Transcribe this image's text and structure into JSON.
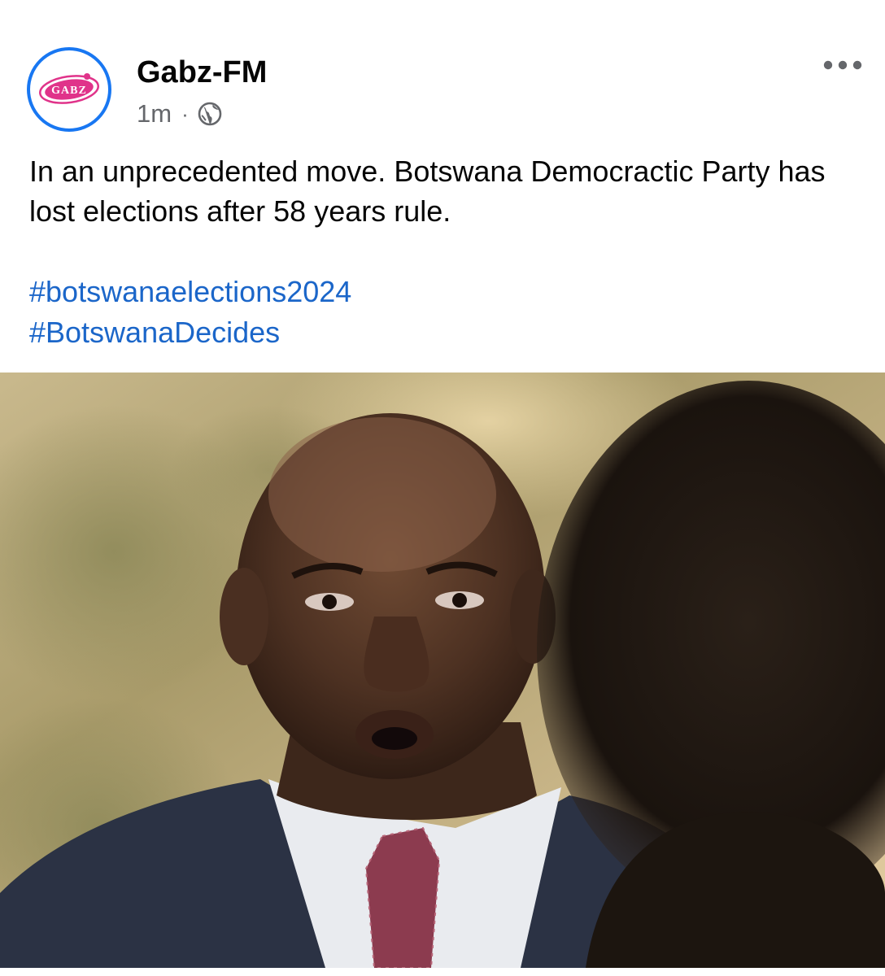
{
  "post": {
    "page_name": "Gabz-FM",
    "avatar_logo_text": "GABZ",
    "timestamp": "1m",
    "separator": "·",
    "audience_icon": "globe-icon",
    "more_icon": "more-horizontal-icon",
    "text": "In an unprecedented move. Botswana Democractic Party has lost elections after 58 years rule.",
    "hashtags": [
      "#botswanaelections2024",
      "#BotswanaDecides"
    ],
    "photo_description": "Close-up photo of a man in a suit and tie speaking outdoors, with a blurred figure in the foreground",
    "colors": {
      "avatar_ring": "#1877f2",
      "logo_pink": "#e0338a",
      "hashtag": "#1b66c9",
      "meta_gray": "#65676b",
      "text": "#050505"
    }
  }
}
